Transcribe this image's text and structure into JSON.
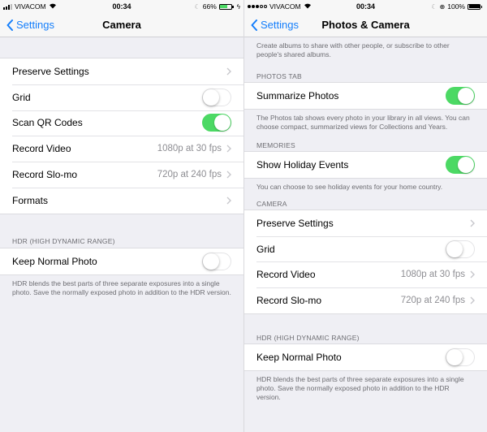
{
  "left": {
    "status": {
      "carrier": "VIVACOM",
      "time": "00:34",
      "battery": "66%",
      "battery_fraction": 0.66,
      "battery_color": "#4cd964"
    },
    "nav": {
      "back_label": "Settings",
      "title": "Camera"
    },
    "group1": [
      {
        "label": "Preserve Settings",
        "value": "",
        "control": "chevron"
      },
      {
        "label": "Grid",
        "control": "toggle",
        "on": false
      },
      {
        "label": "Scan QR Codes",
        "control": "toggle",
        "on": true
      },
      {
        "label": "Record Video",
        "value": "1080p at 30 fps",
        "control": "chevron"
      },
      {
        "label": "Record Slo-mo",
        "value": "720p at 240 fps",
        "control": "chevron"
      },
      {
        "label": "Formats",
        "value": "",
        "control": "chevron"
      }
    ],
    "hdr": {
      "header": "HDR (HIGH DYNAMIC RANGE)",
      "row": {
        "label": "Keep Normal Photo",
        "on": false
      },
      "footer": "HDR blends the best parts of three separate exposures into a single photo. Save the normally exposed photo in addition to the HDR version."
    }
  },
  "right": {
    "status": {
      "carrier": "VIVACOM",
      "time": "00:34",
      "battery": "100%",
      "battery_fraction": 1.0,
      "battery_color": "#000000"
    },
    "nav": {
      "back_label": "Settings",
      "title": "Photos & Camera"
    },
    "shared_footer": "Create albums to share with other people, or subscribe to other people's shared albums.",
    "photos_tab": {
      "header": "PHOTOS TAB",
      "row": {
        "label": "Summarize Photos",
        "on": true
      },
      "footer": "The Photos tab shows every photo in your library in all views. You can choose compact, summarized views for Collections and Years."
    },
    "memories": {
      "header": "MEMORIES",
      "row": {
        "label": "Show Holiday Events",
        "on": true
      },
      "footer": "You can choose to see holiday events for your home country."
    },
    "camera": {
      "header": "CAMERA",
      "rows": [
        {
          "label": "Preserve Settings",
          "value": "",
          "control": "chevron"
        },
        {
          "label": "Grid",
          "control": "toggle",
          "on": false
        },
        {
          "label": "Record Video",
          "value": "1080p at 30 fps",
          "control": "chevron"
        },
        {
          "label": "Record Slo-mo",
          "value": "720p at 240 fps",
          "control": "chevron"
        }
      ]
    },
    "hdr": {
      "header": "HDR (HIGH DYNAMIC RANGE)",
      "row": {
        "label": "Keep Normal Photo",
        "on": false
      },
      "footer": "HDR blends the best parts of three separate exposures into a single photo. Save the normally exposed photo in addition to the HDR version."
    }
  },
  "colors": {
    "accent": "#147efb",
    "toggle_on": "#4cd964",
    "background": "#efeff4"
  }
}
